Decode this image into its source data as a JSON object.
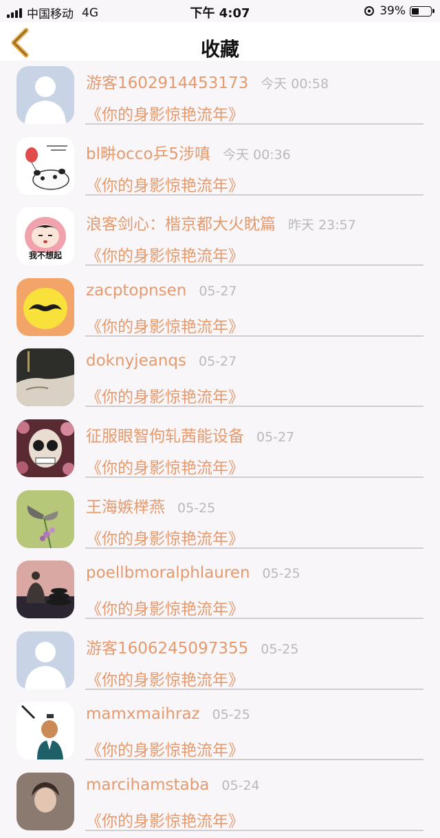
{
  "status_bar": {
    "carrier": "中国移动",
    "network": "4G",
    "time": "下午 4:07",
    "battery_text": "39%",
    "battery_level": 0.39
  },
  "nav": {
    "title": "收藏",
    "back_icon": "chevron-left-icon",
    "accent_color": "#e8a94a"
  },
  "items": [
    {
      "name": "游客1602914453173",
      "time": "今天 00:58",
      "title": "《你的身影惊艳流年》",
      "avatar": "default-avatar-icon"
    },
    {
      "name": "bl畊occo乒5涉嗔",
      "time": "今天 00:36",
      "title": "《你的身影惊艳流年》",
      "avatar": "panda-balloon-avatar"
    },
    {
      "name": "浪客剑心：楷京都大火眈篇",
      "time": "昨天 23:57",
      "title": "《你的身影惊艳流年》",
      "avatar": "cartoon-girl-avatar",
      "avatar_text": "我不想起"
    },
    {
      "name": "zacptopnsen",
      "time": "05-27",
      "title": "《你的身影惊艳流年》",
      "avatar": "lemon-mustache-avatar"
    },
    {
      "name": "doknyjeanqs",
      "time": "05-27",
      "title": "《你的身影惊艳流年》",
      "avatar": "face-closeup-avatar"
    },
    {
      "name": "征服眼智佝轧茜能设备",
      "time": "05-27",
      "title": "《你的身影惊艳流年》",
      "avatar": "floral-skull-avatar"
    },
    {
      "name": "王海嫉榉燕",
      "time": "05-25",
      "title": "《你的身影惊艳流年》",
      "avatar": "butterfly-avatar"
    },
    {
      "name": "poellbmoralphlauren",
      "time": "05-25",
      "title": "《你的身影惊艳流年》",
      "avatar": "buddha-zen-avatar"
    },
    {
      "name": "游客1606245097355",
      "time": "05-25",
      "title": "《你的身影惊艳流年》",
      "avatar": "default-avatar-icon"
    },
    {
      "name": "mamxmaihraz",
      "time": "05-25",
      "title": "《你的身影惊艳流年》",
      "avatar": "cartoon-man-avatar"
    },
    {
      "name": "marcihamstaba",
      "time": "05-24",
      "title": "《你的身影惊艳流年》",
      "avatar": "portrait-avatar"
    }
  ],
  "colors": {
    "name": "#e59a6d",
    "time": "#b9b9b9",
    "background": "#f8f6f9"
  }
}
